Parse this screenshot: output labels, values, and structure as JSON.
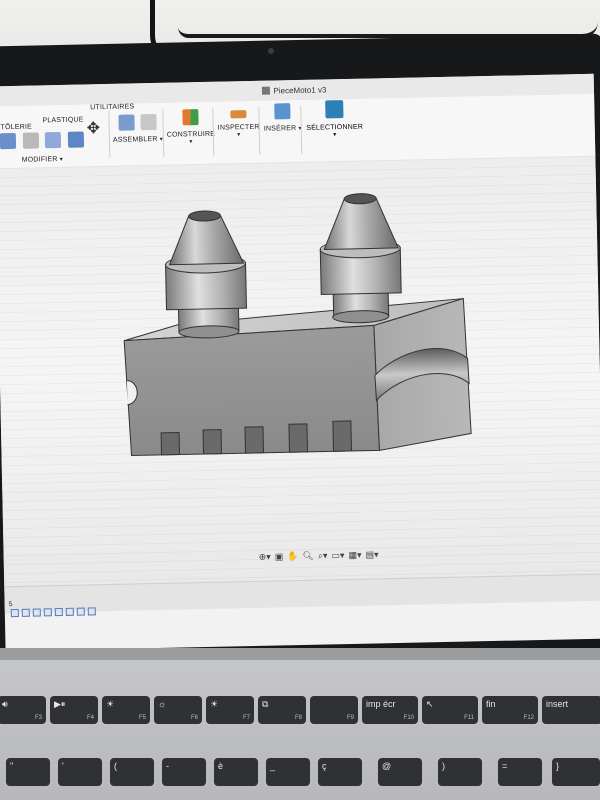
{
  "window": {
    "title": "PieceMoto1 v3"
  },
  "ribbon": {
    "tabs": {
      "sheet": "TÔLERIE",
      "plastic": "PLASTIQUE",
      "utilities": "UTILITAIRES"
    },
    "groups": {
      "modify": "MODIFIER",
      "assemble": "ASSEMBLER",
      "construct": "CONSTRUIRE",
      "inspect": "INSPECTER",
      "insert": "INSÉRER",
      "select": "SÉLECTIONNER"
    },
    "caret": "▾"
  },
  "timeline": {
    "counter": "5"
  },
  "keyboard": {
    "keys": [
      {
        "label": "🔊︎",
        "fn": "F3"
      },
      {
        "label": "▶︎⏸︎",
        "fn": "F4"
      },
      {
        "label": "☀︎",
        "fn": "F5"
      },
      {
        "label": "☼",
        "fn": "F6"
      },
      {
        "label": "☀︎",
        "fn": "F7"
      },
      {
        "label": "⧉",
        "fn": "F8"
      },
      {
        "label": "",
        "fn": "F9"
      },
      {
        "label": "imp écr",
        "fn": "F10"
      },
      {
        "label": "↖",
        "fn": "F11"
      },
      {
        "label": "fin",
        "fn": "F12"
      },
      {
        "label": "insert",
        "fn": ""
      }
    ],
    "row2": [
      {
        "label": "\""
      },
      {
        "label": "'"
      },
      {
        "label": "("
      },
      {
        "label": "-"
      },
      {
        "label": "è"
      },
      {
        "label": "_"
      },
      {
        "label": "ç"
      },
      {
        "label": "@"
      },
      {
        "label": ")"
      },
      {
        "label": "="
      },
      {
        "label": "}"
      }
    ]
  },
  "colors": {
    "accent": "#2b6cb0",
    "metal": "#9a9a9a"
  }
}
